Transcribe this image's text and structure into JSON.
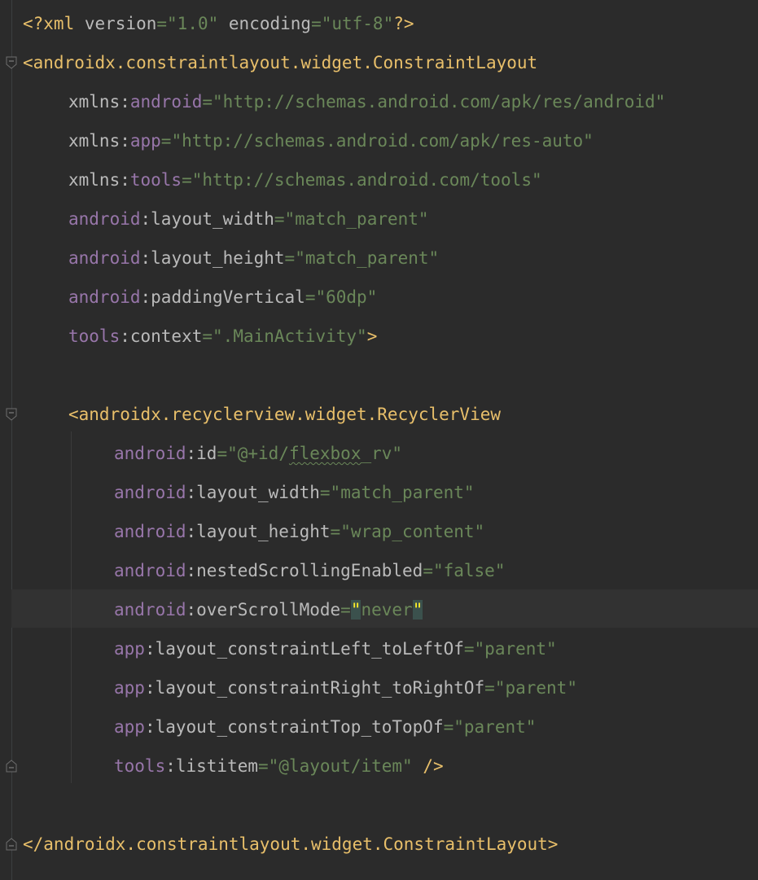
{
  "colors": {
    "background": "#2b2b2b",
    "tag": "#e8bf6a",
    "attribute": "#bababa",
    "namespace": "#9876aa",
    "value": "#6a8759",
    "current_line": "#323232"
  },
  "icons": [
    "fold-icon"
  ],
  "code": {
    "l1": {
      "open": "<?xml ",
      "a1": "version",
      "eq1": "=",
      "v1": "\"1.0\"",
      "sp": " ",
      "a2": "encoding",
      "eq2": "=",
      "v2": "\"utf-8\"",
      "close": "?>"
    },
    "l2": {
      "tag": "<androidx.constraintlayout.widget.ConstraintLayout"
    },
    "l3": {
      "attr": "xmlns:",
      "ns": "android",
      "eq": "=",
      "val": "\"http://schemas.android.com/apk/res/android\""
    },
    "l4": {
      "attr": "xmlns:",
      "ns": "app",
      "eq": "=",
      "val": "\"http://schemas.android.com/apk/res-auto\""
    },
    "l5": {
      "attr": "xmlns:",
      "ns": "tools",
      "eq": "=",
      "val": "\"http://schemas.android.com/tools\""
    },
    "l6": {
      "ns": "android",
      "attr": ":layout_width",
      "eq": "=",
      "val": "\"match_parent\""
    },
    "l7": {
      "ns": "android",
      "attr": ":layout_height",
      "eq": "=",
      "val": "\"match_parent\""
    },
    "l8": {
      "ns": "android",
      "attr": ":paddingVertical",
      "eq": "=",
      "val": "\"60dp\""
    },
    "l9": {
      "ns": "tools",
      "attr": ":context",
      "eq": "=",
      "val": "\".MainActivity\"",
      "close": ">"
    },
    "l11": {
      "tag": "<androidx.recyclerview.widget.RecyclerView"
    },
    "l12": {
      "ns": "android",
      "attr": ":id",
      "eq": "=",
      "val1": "\"@+id/",
      "val2": "flexbox",
      "val3": "_rv\""
    },
    "l13": {
      "ns": "android",
      "attr": ":layout_width",
      "eq": "=",
      "val": "\"match_parent\""
    },
    "l14": {
      "ns": "android",
      "attr": ":layout_height",
      "eq": "=",
      "val": "\"wrap_content\""
    },
    "l15": {
      "ns": "android",
      "attr": ":nestedScrollingEnabled",
      "eq": "=",
      "val": "\"false\""
    },
    "l16": {
      "ns": "android",
      "attr": ":overScrollMode",
      "eq": "=",
      "q1": "\"",
      "val": "never",
      "q2": "\""
    },
    "l17": {
      "ns": "app",
      "attr": ":layout_constraintLeft_toLeftOf",
      "eq": "=",
      "val": "\"parent\""
    },
    "l18": {
      "ns": "app",
      "attr": ":layout_constraintRight_toRightOf",
      "eq": "=",
      "val": "\"parent\""
    },
    "l19": {
      "ns": "app",
      "attr": ":layout_constraintTop_toTopOf",
      "eq": "=",
      "val": "\"parent\""
    },
    "l20": {
      "ns": "tools",
      "attr": ":listitem",
      "eq": "=",
      "val": "\"@layout/item\"",
      "close": " />"
    },
    "l22": {
      "tag": "</androidx.constraintlayout.widget.ConstraintLayout",
      "close": ">"
    }
  }
}
